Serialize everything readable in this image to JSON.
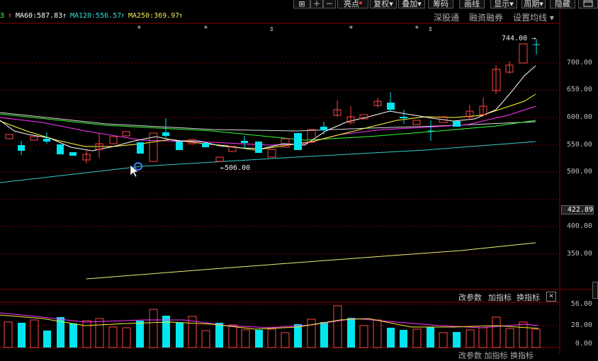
{
  "toolbar": {
    "buttons": [
      {
        "label": "⊞",
        "icon": "grid-icon"
      },
      {
        "label": "＋",
        "icon": "plus-icon"
      },
      {
        "label": "－",
        "icon": "minus-icon"
      },
      {
        "label": "亮点",
        "dot_color": "#ff3333"
      },
      {
        "label": "复权▾"
      },
      {
        "label": "叠加▾"
      },
      {
        "label": "筹码"
      },
      {
        "label": "画线"
      },
      {
        "label": "显示▾"
      },
      {
        "label": "周期▾"
      },
      {
        "label": "隐藏"
      }
    ],
    "window_icon": "window-icon"
  },
  "ma_legend": {
    "prefix": "3",
    "items": [
      {
        "label": "MA60:587.83",
        "color": "#ffffff"
      },
      {
        "label": "MA120:556.57",
        "color": "#33dddd"
      },
      {
        "label": "MA250:369.97",
        "color": "#eeee55"
      }
    ]
  },
  "top_tools": {
    "tool1": "深股通",
    "tool2": "融资融券",
    "tool3": "设置均线 ▾"
  },
  "price_axis": {
    "ticks": [
      "700.00",
      "650.00",
      "600.00",
      "550.00",
      "500.00",
      "400.00",
      "350.00"
    ],
    "current": "422.89"
  },
  "annotations": {
    "high": "744.00 →",
    "low": "←506.00"
  },
  "markers": [
    "*",
    "*",
    "⇕",
    "*",
    "*",
    "⇕"
  ],
  "volume_tools": {
    "params": "改参数",
    "add_indicator": "加指标",
    "switch_indicator": "换指标",
    "close": "✕"
  },
  "volume_axis": {
    "ticks": [
      "56.00",
      "28.00",
      "0.00"
    ]
  },
  "volume_bottom_partial": "改参数  加指标  换指标",
  "colors": {
    "up": "#ff4444",
    "down": "#00e5ee",
    "grid": "#8b0000",
    "ma5": "#ffffff",
    "ma10": "#ffff33",
    "ma20": "#ff33ff",
    "ma30": "#33ff33",
    "ma120": "#33cccc",
    "ma250": "#eeee77"
  }
}
